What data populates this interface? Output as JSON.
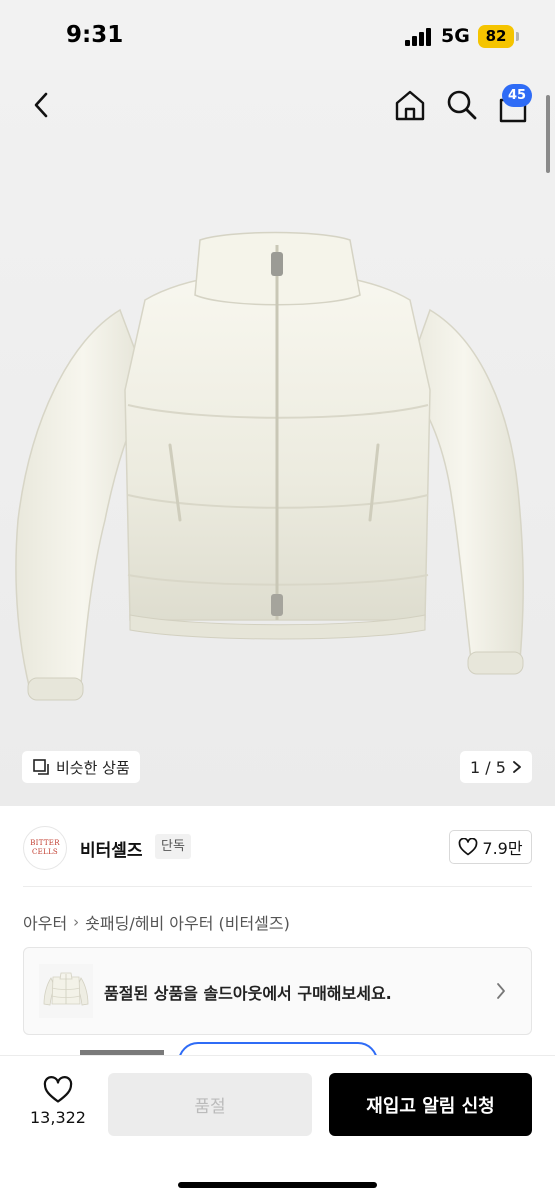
{
  "status_bar": {
    "time": "9:31",
    "network": "5G",
    "battery": "82",
    "battery_color": "#f5c400"
  },
  "nav": {
    "back_icon": "chevron-left-icon",
    "home_icon": "home-icon",
    "search_icon": "search-icon",
    "cart_icon": "shopping-bag-icon",
    "cart_badge": "45",
    "badge_color": "#2f6cf6"
  },
  "gallery": {
    "similar_label": "비슷한 상품",
    "page_indicator": "1 / 5"
  },
  "brand": {
    "logo_line1": "BITTER",
    "logo_line2": "CELLS",
    "name": "비터셀즈",
    "tag": "단독",
    "like_count": "7.9만"
  },
  "breadcrumb": {
    "category": "아우터",
    "subcategory": "숏패딩/헤비 아우터 (비터셀즈)"
  },
  "soldout_banner": {
    "text": "품절된 상품을 솔드아웃에서 구매해보세요."
  },
  "bottom_bar": {
    "heart_count": "13,322",
    "soldout_label": "품절",
    "restock_label": "재입고 알림 신청"
  }
}
